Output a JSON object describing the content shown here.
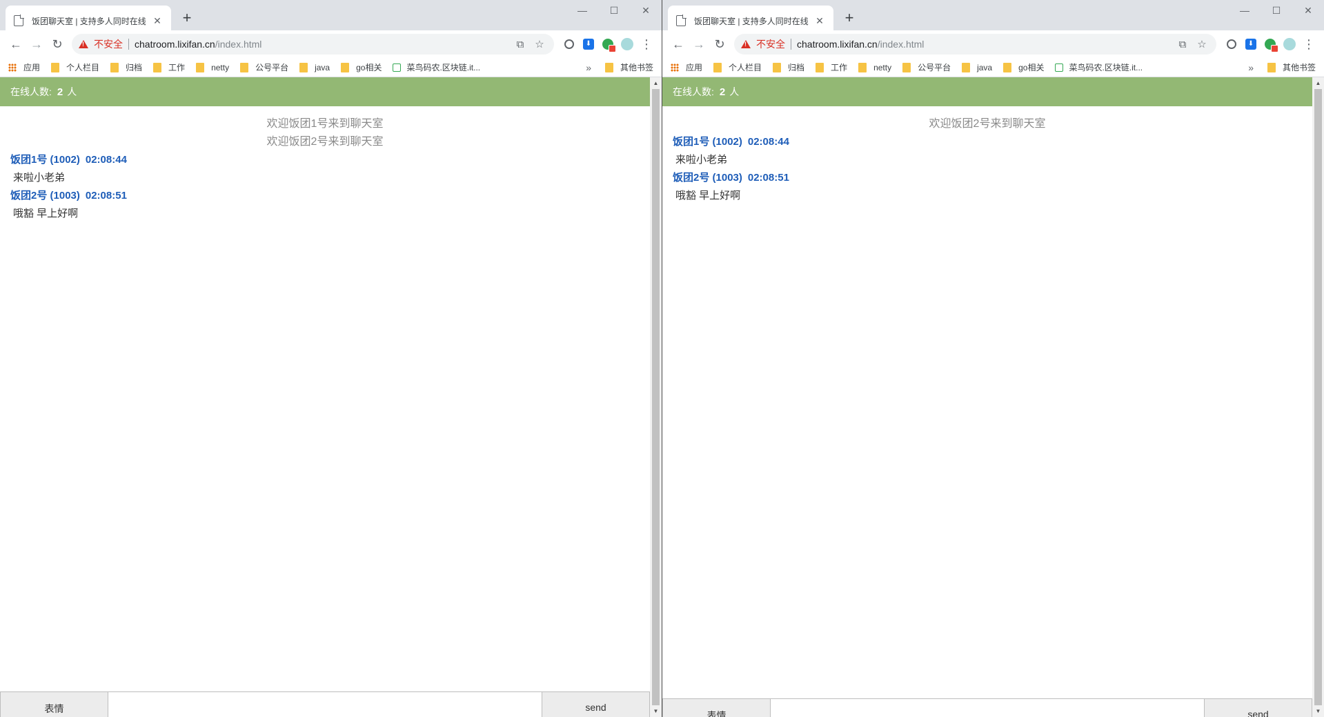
{
  "left": {
    "tab": {
      "title": "饭团聊天室 | 支持多人同时在线",
      "close": "✕",
      "new_tab": "+"
    },
    "window_controls": {
      "minimize": "—",
      "maximize": "☐",
      "close": "✕"
    },
    "nav": {
      "back": "←",
      "forward": "→",
      "reload": "↻"
    },
    "address": {
      "insecure_label": "不安全",
      "host": "chatroom.lixifan.cn",
      "path": "/index.html"
    },
    "omnibox_icons": {
      "translate": "⧉",
      "bookmark_star": "☆"
    },
    "menu": "⋮",
    "bookmarks": [
      {
        "label": "应用",
        "icon": "apps"
      },
      {
        "label": "个人栏目",
        "icon": "folder"
      },
      {
        "label": "归档",
        "icon": "folder"
      },
      {
        "label": "工作",
        "icon": "folder"
      },
      {
        "label": "netty",
        "icon": "folder"
      },
      {
        "label": "公号平台",
        "icon": "folder"
      },
      {
        "label": "java",
        "icon": "folder"
      },
      {
        "label": "go相关",
        "icon": "folder"
      },
      {
        "label": "菜鸟码农.区块链.it...",
        "icon": "site"
      }
    ],
    "bookmarks_more": "»",
    "other_bookmarks": "其他书签",
    "chat": {
      "online_label": "在线人数:",
      "online_count": "2",
      "online_unit": "人",
      "system_messages": [
        "欢迎饭团1号来到聊天室",
        "欢迎饭团2号来到聊天室"
      ],
      "messages": [
        {
          "user": "饭团1号 (1002)",
          "time": "02:08:44",
          "text": "来啦小老弟"
        },
        {
          "user": "饭团2号 (1003)",
          "time": "02:08:51",
          "text": "哦豁 早上好啊"
        }
      ],
      "emoji_label": "表情",
      "input_value": "",
      "send_label": "send"
    }
  },
  "right": {
    "tab": {
      "title": "饭团聊天室 | 支持多人同时在线",
      "close": "✕",
      "new_tab": "+"
    },
    "window_controls": {
      "minimize": "—",
      "maximize": "☐",
      "close": "✕"
    },
    "nav": {
      "back": "←",
      "forward": "→",
      "reload": "↻"
    },
    "address": {
      "insecure_label": "不安全",
      "host": "chatroom.lixifan.cn",
      "path": "/index.html"
    },
    "omnibox_icons": {
      "translate": "⧉",
      "bookmark_star": "☆"
    },
    "menu": "⋮",
    "bookmarks": [
      {
        "label": "应用",
        "icon": "apps"
      },
      {
        "label": "个人栏目",
        "icon": "folder"
      },
      {
        "label": "归档",
        "icon": "folder"
      },
      {
        "label": "工作",
        "icon": "folder"
      },
      {
        "label": "netty",
        "icon": "folder"
      },
      {
        "label": "公号平台",
        "icon": "folder"
      },
      {
        "label": "java",
        "icon": "folder"
      },
      {
        "label": "go相关",
        "icon": "folder"
      },
      {
        "label": "菜鸟码农.区块链.it...",
        "icon": "site"
      }
    ],
    "bookmarks_more": "»",
    "other_bookmarks": "其他书签",
    "chat": {
      "online_label": "在线人数:",
      "online_count": "2",
      "online_unit": "人",
      "system_messages": [
        "欢迎饭团2号来到聊天室"
      ],
      "messages": [
        {
          "user": "饭团1号 (1002)",
          "time": "02:08:44",
          "text": "来啦小老弟"
        },
        {
          "user": "饭团2号 (1003)",
          "time": "02:08:51",
          "text": "哦豁 早上好啊"
        }
      ],
      "emoji_label": "表情",
      "input_value": "",
      "send_label": "send"
    }
  },
  "colors": {
    "online_bar": "#93b874",
    "username": "#1e5db8",
    "system_message": "#8a8a8a",
    "insecure": "#d93025"
  }
}
